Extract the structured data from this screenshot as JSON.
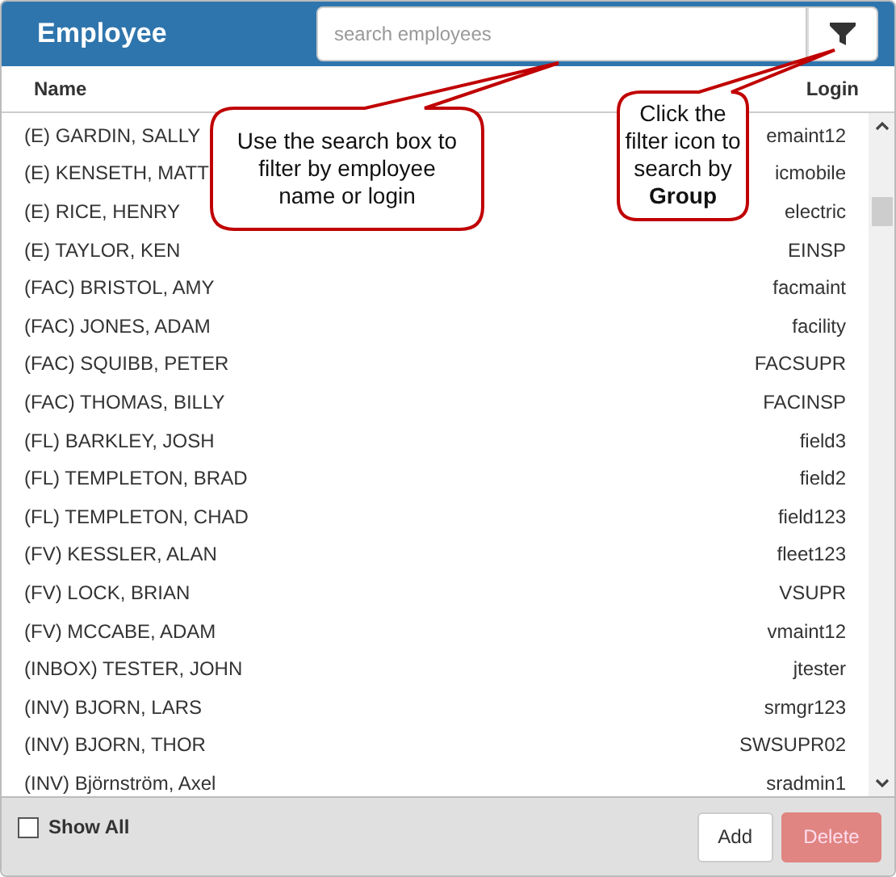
{
  "header": {
    "title": "Employee",
    "search": {
      "placeholder": "search employees"
    }
  },
  "columns": [
    "Name",
    "Login"
  ],
  "rows": [
    {
      "name": "(E) GARDIN, SALLY",
      "login": "emaint12"
    },
    {
      "name": "(E) KENSETH, MATT",
      "login": "icmobile"
    },
    {
      "name": "(E) RICE, HENRY",
      "login": "electric"
    },
    {
      "name": "(E) TAYLOR, KEN",
      "login": "EINSP"
    },
    {
      "name": "(FAC) BRISTOL, AMY",
      "login": "facmaint"
    },
    {
      "name": "(FAC) JONES, ADAM",
      "login": "facility"
    },
    {
      "name": "(FAC) SQUIBB, PETER",
      "login": "FACSUPR"
    },
    {
      "name": "(FAC) THOMAS, BILLY",
      "login": "FACINSP"
    },
    {
      "name": "(FL) BARKLEY, JOSH",
      "login": "field3"
    },
    {
      "name": "(FL) TEMPLETON, BRAD",
      "login": "field2"
    },
    {
      "name": "(FL) TEMPLETON, CHAD",
      "login": "field123"
    },
    {
      "name": "(FV) KESSLER, ALAN",
      "login": "fleet123"
    },
    {
      "name": "(FV) LOCK, BRIAN",
      "login": "VSUPR"
    },
    {
      "name": "(FV) MCCABE, ADAM",
      "login": "vmaint12"
    },
    {
      "name": "(INBOX) TESTER, JOHN",
      "login": "jtester"
    },
    {
      "name": "(INV) BJORN, LARS",
      "login": "srmgr123"
    },
    {
      "name": "(INV) BJORN, THOR",
      "login": "SWSUPR02"
    },
    {
      "name": "(INV) Björnström, Axel",
      "login": "sradmin1"
    }
  ],
  "callouts": [
    "Use the search box to filter by employee name or login",
    "Click the filter icon to search by **Group**"
  ],
  "footer": {
    "show_all": {
      "label": "Show All",
      "checked": false
    },
    "buttons": [
      {
        "label": "Add",
        "kind": "default",
        "disabled": false
      },
      {
        "label": "Delete",
        "kind": "danger",
        "disabled": true
      }
    ]
  }
}
